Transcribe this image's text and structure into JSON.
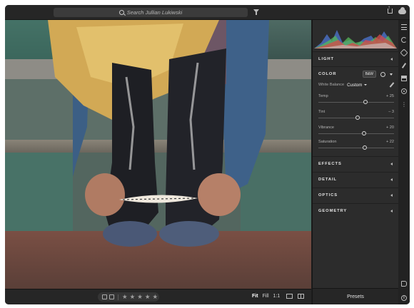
{
  "search": {
    "placeholder": "Search Jullian Lukiwski"
  },
  "edit_panel": {
    "sections": {
      "light": "LIGHT",
      "color": "COLOR",
      "effects": "EFFECTS",
      "detail": "DETAIL",
      "optics": "OPTICS",
      "geometry": "GEOMETRY"
    },
    "bw_label": "B&W",
    "white_balance": {
      "label": "White Balance",
      "value": "Custom"
    },
    "sliders": [
      {
        "label": "Temp",
        "value": "+ 25",
        "fraction": 0.62
      },
      {
        "label": "Tint",
        "value": "– 3",
        "fraction": 0.52
      },
      {
        "label": "Vibrance",
        "value": "+ 20",
        "fraction": 0.6
      },
      {
        "label": "Saturation",
        "value": "+ 22",
        "fraction": 0.61
      }
    ],
    "presets_label": "Presets"
  },
  "bottom_bar": {
    "view_fit": "Fit",
    "view_fill": "Fill",
    "view_1to1": "1:1",
    "stars": [
      "★",
      "★",
      "★",
      "★",
      "★"
    ]
  },
  "colors": {
    "accent": "#d7d7d7",
    "panel_bg": "#2c2c2c",
    "histogram_red": "#d84a4a",
    "histogram_green": "#55b85a",
    "histogram_blue": "#4b72c9"
  }
}
